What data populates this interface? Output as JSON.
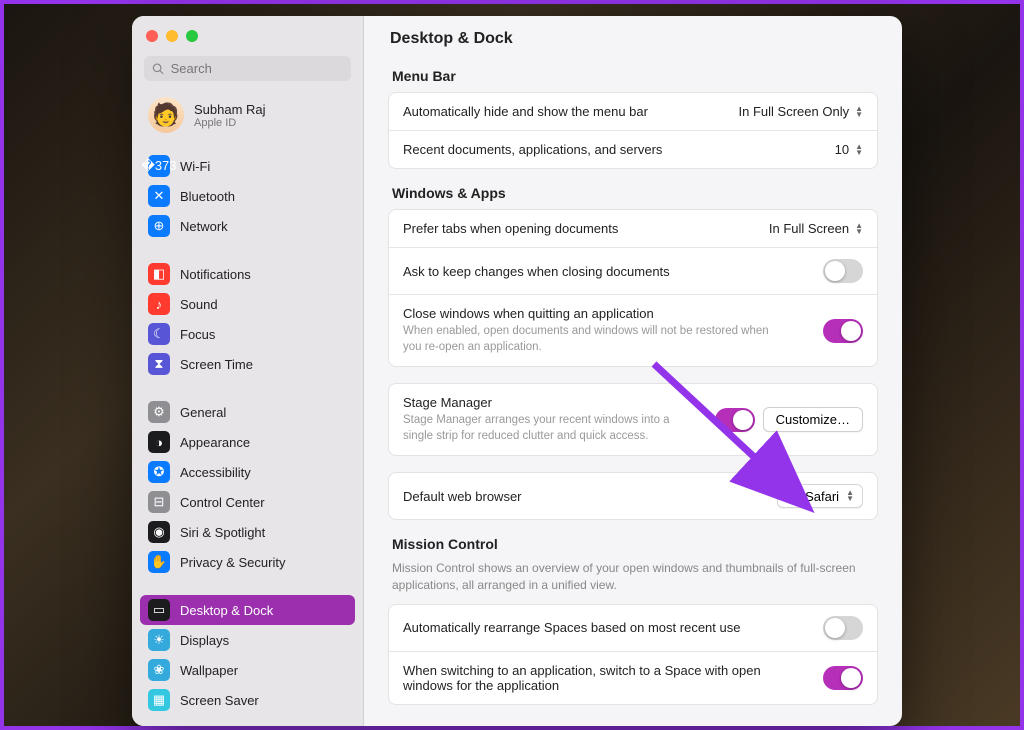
{
  "search": {
    "placeholder": "Search"
  },
  "profile": {
    "name": "Subham Raj",
    "sub": "Apple ID"
  },
  "sidebar": {
    "groups": [
      [
        {
          "label": "Wi-Fi",
          "color": "#0a7aff",
          "glyph": "�373"
        },
        {
          "label": "Bluetooth",
          "color": "#0a7aff",
          "glyph": "✕"
        },
        {
          "label": "Network",
          "color": "#0a7aff",
          "glyph": "⊕"
        }
      ],
      [
        {
          "label": "Notifications",
          "color": "#ff3b30",
          "glyph": "◧"
        },
        {
          "label": "Sound",
          "color": "#ff3b30",
          "glyph": "♪"
        },
        {
          "label": "Focus",
          "color": "#5856d6",
          "glyph": "☾"
        },
        {
          "label": "Screen Time",
          "color": "#5856d6",
          "glyph": "⧗"
        }
      ],
      [
        {
          "label": "General",
          "color": "#8e8e93",
          "glyph": "⚙"
        },
        {
          "label": "Appearance",
          "color": "#1c1c1e",
          "glyph": "◑"
        },
        {
          "label": "Accessibility",
          "color": "#0a7aff",
          "glyph": "✪"
        },
        {
          "label": "Control Center",
          "color": "#8e8e93",
          "glyph": "⊟"
        },
        {
          "label": "Siri & Spotlight",
          "color": "#1c1c1e",
          "glyph": "◉"
        },
        {
          "label": "Privacy & Security",
          "color": "#0a7aff",
          "glyph": "✋"
        }
      ],
      [
        {
          "label": "Desktop & Dock",
          "color": "#1c1c1e",
          "glyph": "▭",
          "active": true
        },
        {
          "label": "Displays",
          "color": "#34aadc",
          "glyph": "☀"
        },
        {
          "label": "Wallpaper",
          "color": "#34aadc",
          "glyph": "❀"
        },
        {
          "label": "Screen Saver",
          "color": "#34c7e0",
          "glyph": "▦"
        }
      ]
    ]
  },
  "page": {
    "title": "Desktop & Dock"
  },
  "menubar": {
    "header": "Menu Bar",
    "autohide_label": "Automatically hide and show the menu bar",
    "autohide_value": "In Full Screen Only",
    "recents_label": "Recent documents, applications, and servers",
    "recents_value": "10"
  },
  "winapps": {
    "header": "Windows & Apps",
    "tabs_label": "Prefer tabs when opening documents",
    "tabs_value": "In Full Screen",
    "askkeep_label": "Ask to keep changes when closing documents",
    "closewin_label": "Close windows when quitting an application",
    "closewin_desc": "When enabled, open documents and windows will not be restored when you re-open an application.",
    "stage_label": "Stage Manager",
    "stage_desc": "Stage Manager arranges your recent windows into a single strip for reduced clutter and quick access.",
    "customize_label": "Customize…",
    "browser_label": "Default web browser",
    "browser_value": "Safari"
  },
  "toggles": {
    "askkeep": false,
    "closewin": true,
    "stage": true,
    "auto_rearrange": false,
    "switch_space": true
  },
  "mission": {
    "header": "Mission Control",
    "desc": "Mission Control shows an overview of your open windows and thumbnails of full-screen applications, all arranged in a unified view.",
    "auto_rearrange_label": "Automatically rearrange Spaces based on most recent use",
    "switch_space_label": "When switching to an application, switch to a Space with open windows for the application"
  }
}
